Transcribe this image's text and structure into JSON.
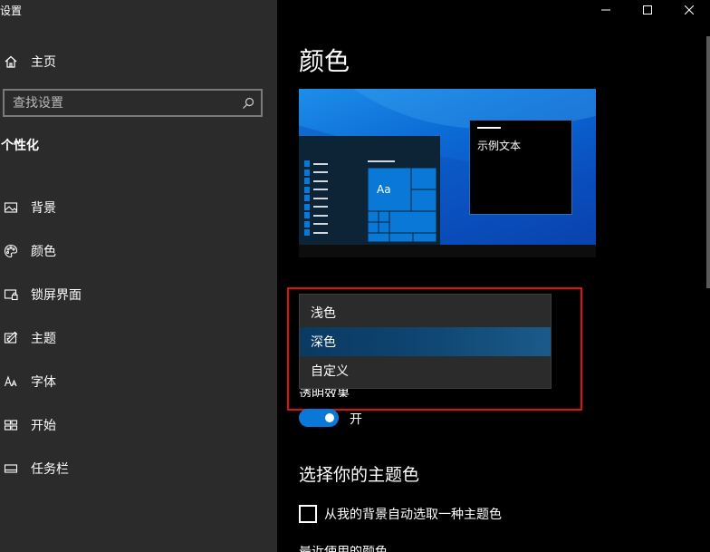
{
  "app": {
    "title": "设置"
  },
  "sidebar": {
    "home_label": "主页",
    "search_placeholder": "查找设置",
    "section_title": "个性化",
    "items": [
      {
        "label": "背景",
        "icon": "image-icon"
      },
      {
        "label": "颜色",
        "icon": "palette-icon"
      },
      {
        "label": "锁屏界面",
        "icon": "lock-screen-icon"
      },
      {
        "label": "主题",
        "icon": "theme-icon"
      },
      {
        "label": "字体",
        "icon": "font-icon"
      },
      {
        "label": "开始",
        "icon": "start-icon"
      },
      {
        "label": "任务栏",
        "icon": "taskbar-icon"
      }
    ]
  },
  "main": {
    "page_title": "颜色",
    "preview": {
      "tile_text": "Aa",
      "sample_text": "示例文本"
    },
    "mode_dropdown": {
      "options": [
        "浅色",
        "深色",
        "自定义"
      ],
      "selected": "深色"
    },
    "transparency": {
      "label": "透明效果",
      "state": "开",
      "on": true
    },
    "accent_heading": "选择你的主题色",
    "auto_accent_label": "从我的背景自动选取一种主题色",
    "auto_accent_checked": false,
    "next_heading_partial": "最近使用的颜色"
  },
  "colors": {
    "accent": "#0a78d6",
    "highlight_border": "#e01010",
    "sidebar_bg": "#2b2b2b",
    "main_bg": "#000000"
  }
}
